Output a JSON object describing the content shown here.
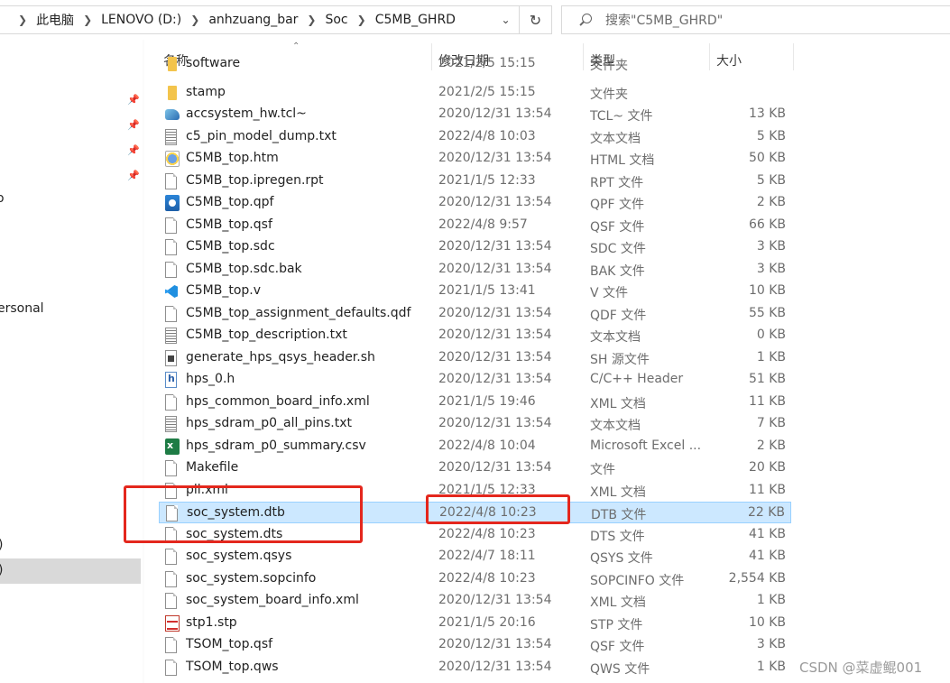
{
  "address": {
    "crumbs": [
      "此电脑",
      "LENOVO (D:)",
      "anhzuang_bar",
      "Soc",
      "C5MB_GHRD"
    ],
    "dropdown_icon": "chevron-down-icon",
    "refresh_icon": "refresh-icon"
  },
  "search": {
    "placeholder": "搜索\"C5MB_GHRD\""
  },
  "nav": {
    "labels": [
      "o",
      "ersonal",
      ")",
      ")"
    ]
  },
  "columns": {
    "name": "名称",
    "date": "修改日期",
    "type": "类型",
    "size": "大小"
  },
  "files": [
    {
      "name": "software",
      "date": "2021/2/5 15:15",
      "type": "文件夹",
      "size": "",
      "icon": "folder-icon"
    },
    {
      "name": "stamp",
      "date": "2021/2/5 15:15",
      "type": "文件夹",
      "size": "",
      "icon": "folder-icon"
    },
    {
      "name": "accsystem_hw.tcl~",
      "date": "2020/12/31 13:54",
      "type": "TCL~ 文件",
      "size": "13 KB",
      "icon": "tcl-file-icon"
    },
    {
      "name": "c5_pin_model_dump.txt",
      "date": "2022/4/8 10:03",
      "type": "文本文档",
      "size": "5 KB",
      "icon": "text-file-icon"
    },
    {
      "name": "C5MB_top.htm",
      "date": "2020/12/31 13:54",
      "type": "HTML 文档",
      "size": "50 KB",
      "icon": "html-file-icon"
    },
    {
      "name": "C5MB_top.ipregen.rpt",
      "date": "2021/1/5 12:33",
      "type": "RPT 文件",
      "size": "5 KB",
      "icon": "file-icon"
    },
    {
      "name": "C5MB_top.qpf",
      "date": "2020/12/31 13:54",
      "type": "QPF 文件",
      "size": "2 KB",
      "icon": "quartus-project-icon"
    },
    {
      "name": "C5MB_top.qsf",
      "date": "2022/4/8 9:57",
      "type": "QSF 文件",
      "size": "66 KB",
      "icon": "file-icon"
    },
    {
      "name": "C5MB_top.sdc",
      "date": "2020/12/31 13:54",
      "type": "SDC 文件",
      "size": "3 KB",
      "icon": "file-icon"
    },
    {
      "name": "C5MB_top.sdc.bak",
      "date": "2020/12/31 13:54",
      "type": "BAK 文件",
      "size": "3 KB",
      "icon": "file-icon"
    },
    {
      "name": "C5MB_top.v",
      "date": "2021/1/5 13:41",
      "type": "V 文件",
      "size": "10 KB",
      "icon": "vscode-file-icon"
    },
    {
      "name": "C5MB_top_assignment_defaults.qdf",
      "date": "2020/12/31 13:54",
      "type": "QDF 文件",
      "size": "55 KB",
      "icon": "file-icon"
    },
    {
      "name": "C5MB_top_description.txt",
      "date": "2020/12/31 13:54",
      "type": "文本文档",
      "size": "0 KB",
      "icon": "text-file-icon"
    },
    {
      "name": "generate_hps_qsys_header.sh",
      "date": "2020/12/31 13:54",
      "type": "SH 源文件",
      "size": "1 KB",
      "icon": "shell-script-icon"
    },
    {
      "name": "hps_0.h",
      "date": "2020/12/31 13:54",
      "type": "C/C++ Header",
      "size": "51 KB",
      "icon": "header-file-icon"
    },
    {
      "name": "hps_common_board_info.xml",
      "date": "2021/1/5 19:46",
      "type": "XML 文档",
      "size": "11 KB",
      "icon": "file-icon"
    },
    {
      "name": "hps_sdram_p0_all_pins.txt",
      "date": "2020/12/31 13:54",
      "type": "文本文档",
      "size": "7 KB",
      "icon": "text-file-icon"
    },
    {
      "name": "hps_sdram_p0_summary.csv",
      "date": "2022/4/8 10:04",
      "type": "Microsoft Excel ...",
      "size": "2 KB",
      "icon": "excel-file-icon"
    },
    {
      "name": "Makefile",
      "date": "2020/12/31 13:54",
      "type": "文件",
      "size": "20 KB",
      "icon": "file-icon"
    },
    {
      "name": "pll.xml",
      "date": "2021/1/5 12:33",
      "type": "XML 文档",
      "size": "11 KB",
      "icon": "file-icon"
    },
    {
      "name": "soc_system.dtb",
      "date": "2022/4/8 10:23",
      "type": "DTB 文件",
      "size": "22 KB",
      "icon": "file-icon",
      "selected": true
    },
    {
      "name": "soc_system.dts",
      "date": "2022/4/8 10:23",
      "type": "DTS 文件",
      "size": "41 KB",
      "icon": "file-icon"
    },
    {
      "name": "soc_system.qsys",
      "date": "2022/4/7 18:11",
      "type": "QSYS 文件",
      "size": "41 KB",
      "icon": "file-icon"
    },
    {
      "name": "soc_system.sopcinfo",
      "date": "2022/4/8 10:23",
      "type": "SOPCINFO 文件",
      "size": "2,554 KB",
      "icon": "file-icon"
    },
    {
      "name": "soc_system_board_info.xml",
      "date": "2020/12/31 13:54",
      "type": "XML 文档",
      "size": "1 KB",
      "icon": "file-icon"
    },
    {
      "name": "stp1.stp",
      "date": "2021/1/5 20:16",
      "type": "STP 文件",
      "size": "10 KB",
      "icon": "signaltap-file-icon"
    },
    {
      "name": "TSOM_top.qsf",
      "date": "2020/12/31 13:54",
      "type": "QSF 文件",
      "size": "3 KB",
      "icon": "file-icon"
    },
    {
      "name": "TSOM_top.qws",
      "date": "2020/12/31 13:54",
      "type": "QWS 文件",
      "size": "1 KB",
      "icon": "file-icon"
    }
  ],
  "watermark": "CSDN @菜虚鲲001",
  "colors": {
    "selection": "#cce8ff",
    "annotation": "#e4271d"
  }
}
